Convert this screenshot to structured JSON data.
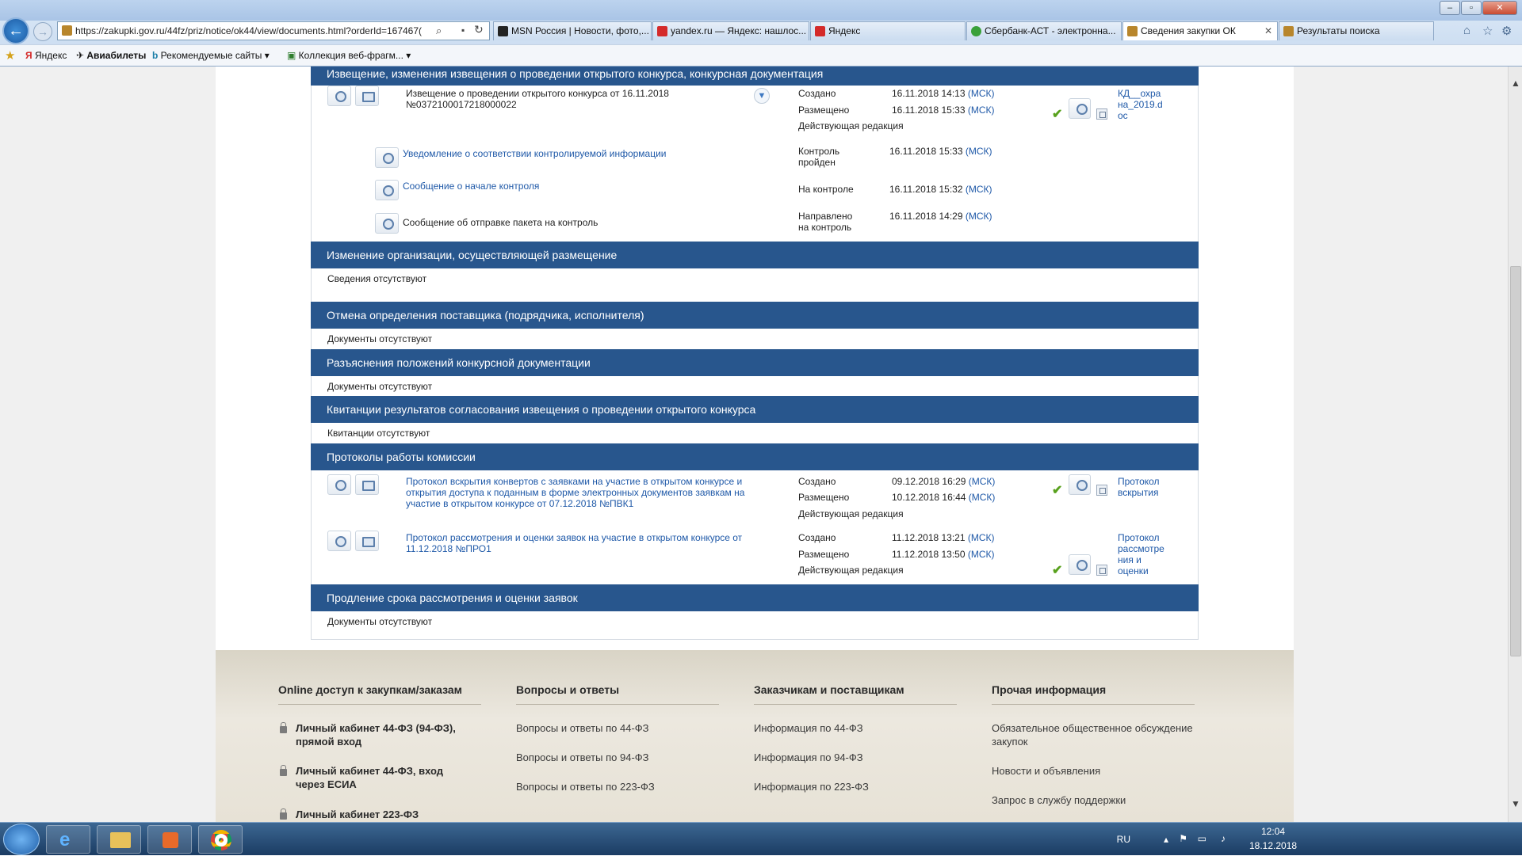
{
  "browser": {
    "address": "https://zakupki.gov.ru/44fz/priz/notice/ok44/view/documents.html?orderId=167467(",
    "tabs": [
      {
        "label": "MSN Россия | Новости, фото,...",
        "icon_color": "#222222"
      },
      {
        "label": "yandex.ru — Яндекс: нашлос...",
        "icon_color": "#d42a2a"
      },
      {
        "label": "Яндекс",
        "icon_color": "#d42a2a"
      },
      {
        "label": "Сбербанк-АСТ - электронна...",
        "icon_color": "#3aa13a"
      },
      {
        "label": "Сведения закупки ОК",
        "icon_color": "#b8862c"
      },
      {
        "label": "Результаты поиска",
        "icon_color": "#b8862c"
      }
    ],
    "favorites": [
      {
        "label": "Яндекс"
      },
      {
        "label": "Авиабилеты"
      },
      {
        "label": "Рекомендуемые сайты ▾"
      },
      {
        "label": "Коллекция веб-фрагм... ▾"
      }
    ]
  },
  "sections": {
    "notice": {
      "title": "Извещение, изменения извещения о проведении открытого конкурса, конкурсная документация",
      "doc_title": "Извещение о проведении открытого конкурса от 16.11.2018 №0372100017218000022",
      "created_label": "Создано",
      "created_value": "16.11.2018 14:13",
      "posted_label": "Размещено",
      "posted_value": "16.11.2018 15:33",
      "edition": "Действующая редакция",
      "file": "КД__охра на_2019.d oc",
      "sub": [
        {
          "text": "Уведомление о соответствии контролируемой информации",
          "link": true,
          "label": "Контроль пройден",
          "value": "16.11.2018 15:33"
        },
        {
          "text": "Сообщение о начале контроля",
          "link": true,
          "label": "На контроле",
          "value": "16.11.2018 15:32"
        },
        {
          "text": "Сообщение об отправке пакета на контроль",
          "link": false,
          "label": "Направлено на контроль",
          "value": "16.11.2018 14:29"
        }
      ]
    },
    "org_change": {
      "title": "Изменение организации, осуществляющей размещение",
      "empty": "Сведения отсутствуют"
    },
    "cancel": {
      "title": "Отмена определения поставщика (подрядчика, исполнителя)",
      "empty": "Документы отсутствуют"
    },
    "clarify": {
      "title": "Разъяснения положений конкурсной документации",
      "empty": "Документы отсутствуют"
    },
    "receipts": {
      "title": "Квитанции результатов согласования извещения о проведении открытого конкурса",
      "empty": "Квитанции отсутствуют"
    },
    "protocols": {
      "title": "Протоколы работы комиссии",
      "items": [
        {
          "text": "Протокол вскрытия конвертов с заявками на участие в открытом конкурсе и открытия доступа к поданным в форме электронных документов заявкам на участие в открытом конкурсе от 07.12.2018 №ПВК1",
          "created": "09.12.2018 16:29",
          "posted": "10.12.2018 16:44",
          "file": "Протокол вскрытия"
        },
        {
          "text": "Протокол рассмотрения и оценки заявок на участие в открытом конкурсе от 11.12.2018 №ПРО1",
          "created": "11.12.2018 13:21",
          "posted": "11.12.2018 13:50",
          "file": "Протокол рассмотре ния и оценки"
        }
      ],
      "created_label": "Создано",
      "posted_label": "Размещено",
      "edition": "Действующая редакция"
    },
    "extend": {
      "title": "Продление срока рассмотрения и оценки заявок",
      "empty": "Документы отсутствуют"
    },
    "tz": "(МСК)"
  },
  "footer": {
    "col1": {
      "title": "Online доступ к закупкам/заказам",
      "items": [
        "Личный кабинет 44-ФЗ (94-ФЗ), прямой вход",
        "Личный кабинет 44-ФЗ, вход через ЕСИА",
        "Личный кабинет 223-ФЗ"
      ]
    },
    "col2": {
      "title": "Вопросы и ответы",
      "items": [
        "Вопросы и ответы по 44-ФЗ",
        "Вопросы и ответы по 94-ФЗ",
        "Вопросы и ответы по 223-ФЗ"
      ]
    },
    "col3": {
      "title": "Заказчикам и поставщикам",
      "items": [
        "Информация по 44-ФЗ",
        "Информация по 94-ФЗ",
        "Информация по 223-ФЗ"
      ]
    },
    "col4": {
      "title": "Прочая информация",
      "items": [
        "Обязательное общественное обсуждение закупок",
        "Новости и объявления",
        "Запрос в службу поддержки"
      ]
    }
  },
  "taskbar": {
    "lang": "RU",
    "time": "12:04",
    "date": "18.12.2018"
  }
}
